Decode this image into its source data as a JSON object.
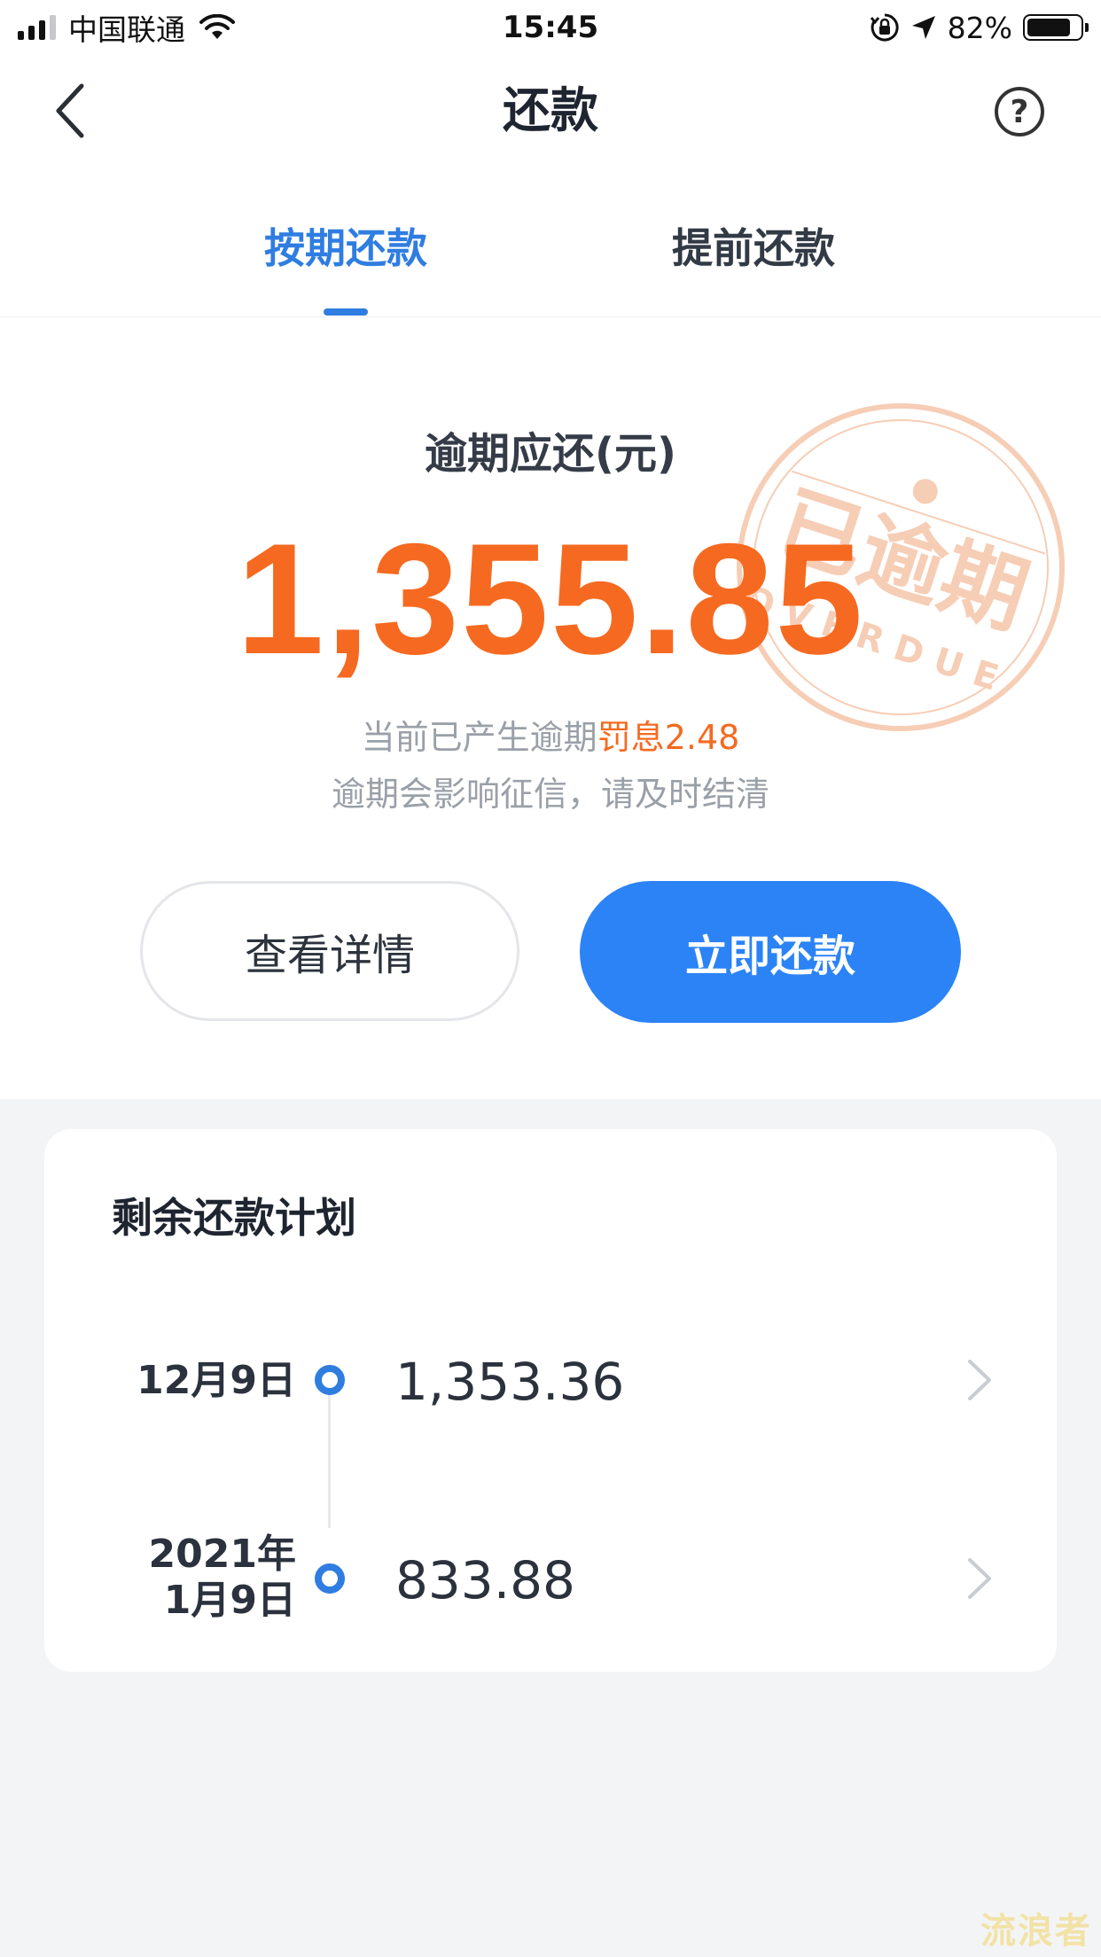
{
  "status_bar": {
    "carrier": "中国联通",
    "time": "15:45",
    "battery_percent": "82%",
    "battery_level": 0.82
  },
  "nav": {
    "title": "还款",
    "back_icon": "chevron-left-icon",
    "help_icon": "question-circle-icon"
  },
  "tabs": [
    {
      "label": "按期还款",
      "active": true
    },
    {
      "label": "提前还款",
      "active": false
    }
  ],
  "summary": {
    "label": "逾期应还(元)",
    "amount": "1,355.85",
    "note_prefix": "当前已产生逾期",
    "penalty_label": "罚息2.48",
    "note_warning": "逾期会影响征信，请及时结清",
    "stamp_text": "已逾期",
    "stamp_subtext": "OVERDUE",
    "accent_color": "#f56a20"
  },
  "buttons": {
    "detail": "查看详情",
    "pay": "立即还款",
    "primary_color": "#2b83f6"
  },
  "plan": {
    "title": "剩余还款计划",
    "rows": [
      {
        "date_line1": "12月9日",
        "date_line2": "",
        "amount": "1,353.36"
      },
      {
        "date_line1": "2021年",
        "date_line2": "1月9日",
        "amount": "833.88"
      }
    ]
  },
  "watermark": "流浪者"
}
